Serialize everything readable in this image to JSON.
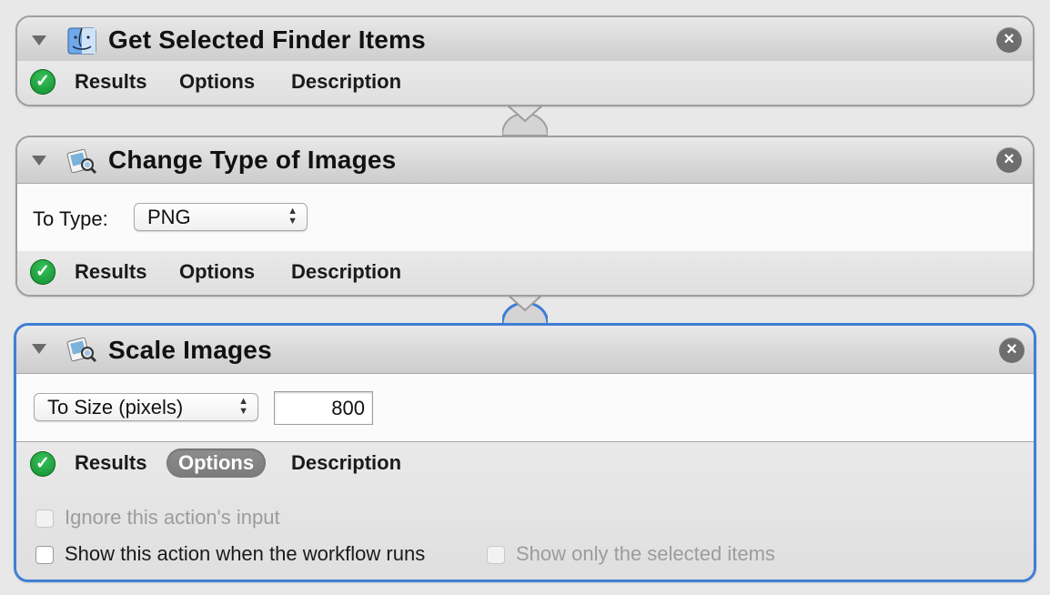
{
  "actions": [
    {
      "title": "Get Selected Finder Items",
      "icon": "finder-icon",
      "tabs": {
        "results": "Results",
        "options": "Options",
        "description": "Description"
      }
    },
    {
      "title": "Change Type of Images",
      "icon": "preview-icon",
      "to_type_label": "To Type:",
      "to_type_value": "PNG",
      "tabs": {
        "results": "Results",
        "options": "Options",
        "description": "Description"
      }
    },
    {
      "title": "Scale Images",
      "icon": "preview-icon",
      "scale_mode": "To Size (pixels)",
      "size_value": "800",
      "tabs": {
        "results": "Results",
        "options": "Options",
        "description": "Description"
      },
      "active_tab": "Options",
      "options": {
        "ignore_input": "Ignore this action's input",
        "show_when_runs": "Show this action when the workflow runs",
        "show_only_selected": "Show only the selected items"
      }
    }
  ],
  "colors": {
    "selection_border": "#3f7ed6",
    "check_green": "#1aa23c",
    "close_button": "#6e6e6e"
  }
}
